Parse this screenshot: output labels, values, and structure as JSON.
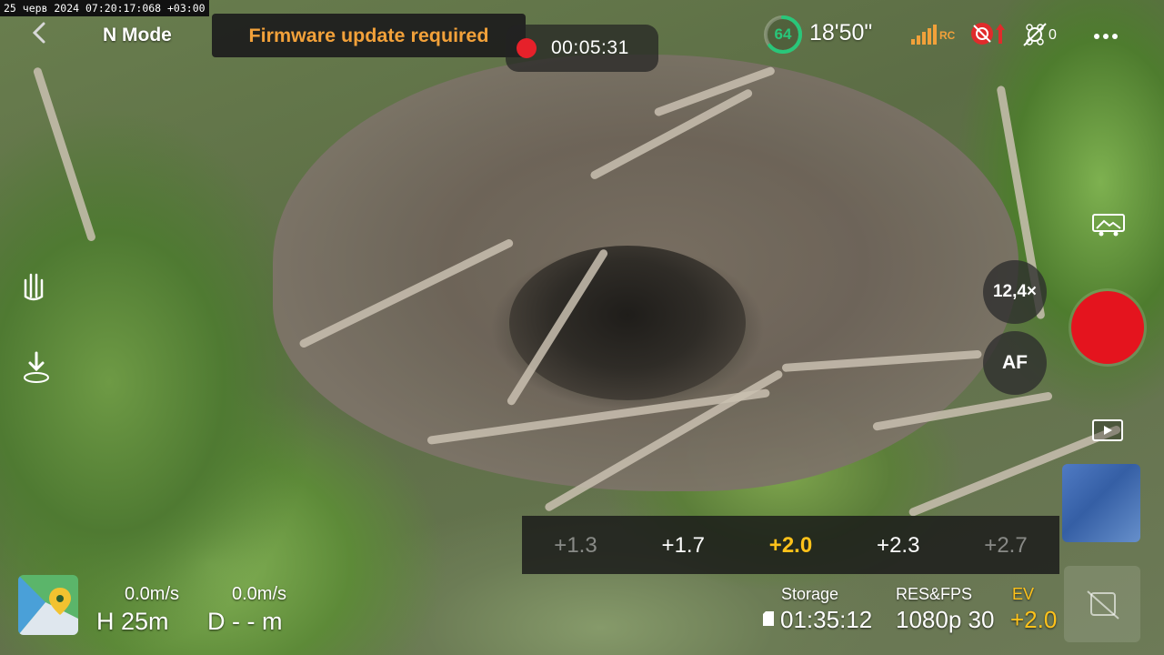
{
  "osd": {
    "timestamp": "25 черв 2024 07:20:17:068 +03:00"
  },
  "topbar": {
    "mode": "N Mode",
    "firmware_banner": "Firmware update required",
    "record_time": "00:05:31",
    "battery_percent": "64",
    "battery_level": 0.64,
    "flight_time_remaining": "18'50\"",
    "signal_label": "RC",
    "obstacle_count": "0"
  },
  "right_controls": {
    "zoom": "12,4×",
    "focus_mode": "AF"
  },
  "ev_scale": {
    "values": [
      "+1.3",
      "+1.7",
      "+2.0",
      "+2.3",
      "+2.7"
    ],
    "selected": "+2.0"
  },
  "telemetry": {
    "horizontal_speed": "0.0m/s",
    "vertical_speed": "0.0m/s",
    "height": "H 25m",
    "distance": "D - - m"
  },
  "camera_status": {
    "storage_label": "Storage",
    "storage_value": "01:35:12",
    "resfps_label": "RES&FPS",
    "resfps_value": "1080p 30",
    "ev_label": "EV",
    "ev_value": "+2.0"
  },
  "colors": {
    "accent": "#f2a13a",
    "record": "#e6212a",
    "ev_selected": "#ffc21a",
    "battery": "#28c77a",
    "warning": "#e02b2b"
  },
  "icons": [
    "back-icon",
    "signal-icon",
    "warning-icon",
    "obstacle-avoidance-icon",
    "more-icon",
    "hand-gesture-icon",
    "landing-icon",
    "gallery-icon",
    "playback-icon",
    "map-pin-icon",
    "mute-icon",
    "storage-icon"
  ]
}
